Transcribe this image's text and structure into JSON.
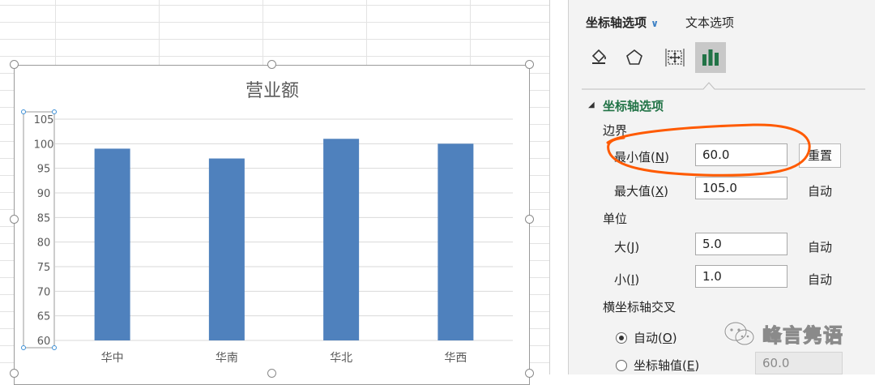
{
  "chart_data": {
    "type": "bar",
    "title": "营业额",
    "categories": [
      "华中",
      "华南",
      "华北",
      "华西"
    ],
    "values": [
      99,
      97,
      101,
      100
    ],
    "ylim": [
      60,
      105
    ],
    "y_ticks": [
      "105",
      "100",
      "95",
      "90",
      "85",
      "80",
      "75",
      "70",
      "65",
      "60"
    ],
    "grid": true,
    "legend": "none",
    "bar_color": "#4f81bd"
  },
  "pane": {
    "tab_axis": "坐标轴选项",
    "tab_text": "文本选项",
    "icons": [
      "fill-bucket-icon",
      "pentagon-icon",
      "size-move-icon",
      "bar-chart-icon"
    ],
    "section_title": "坐标轴选项",
    "bounds_label": "边界",
    "min_label": "最小值",
    "min_key": "N",
    "min_value": "60.0",
    "reset_label": "重置",
    "max_label": "最大值",
    "max_key": "X",
    "max_value": "105.0",
    "max_auto": "自动",
    "units_label": "单位",
    "major_label": "大",
    "major_key": "J",
    "major_value": "5.0",
    "major_auto": "自动",
    "minor_label": "小",
    "minor_key": "I",
    "minor_value": "1.0",
    "minor_auto": "自动",
    "cross_label": "横坐标轴交叉",
    "cross_auto_label": "自动",
    "cross_auto_key": "O",
    "cross_value_label": "坐标轴值",
    "cross_value_key": "E",
    "cross_value": "60.0"
  },
  "watermark": "峰言隽语",
  "colors": {
    "accent": "#217346",
    "annotation": "#ff5a00",
    "selection": "#3b8fd6"
  }
}
